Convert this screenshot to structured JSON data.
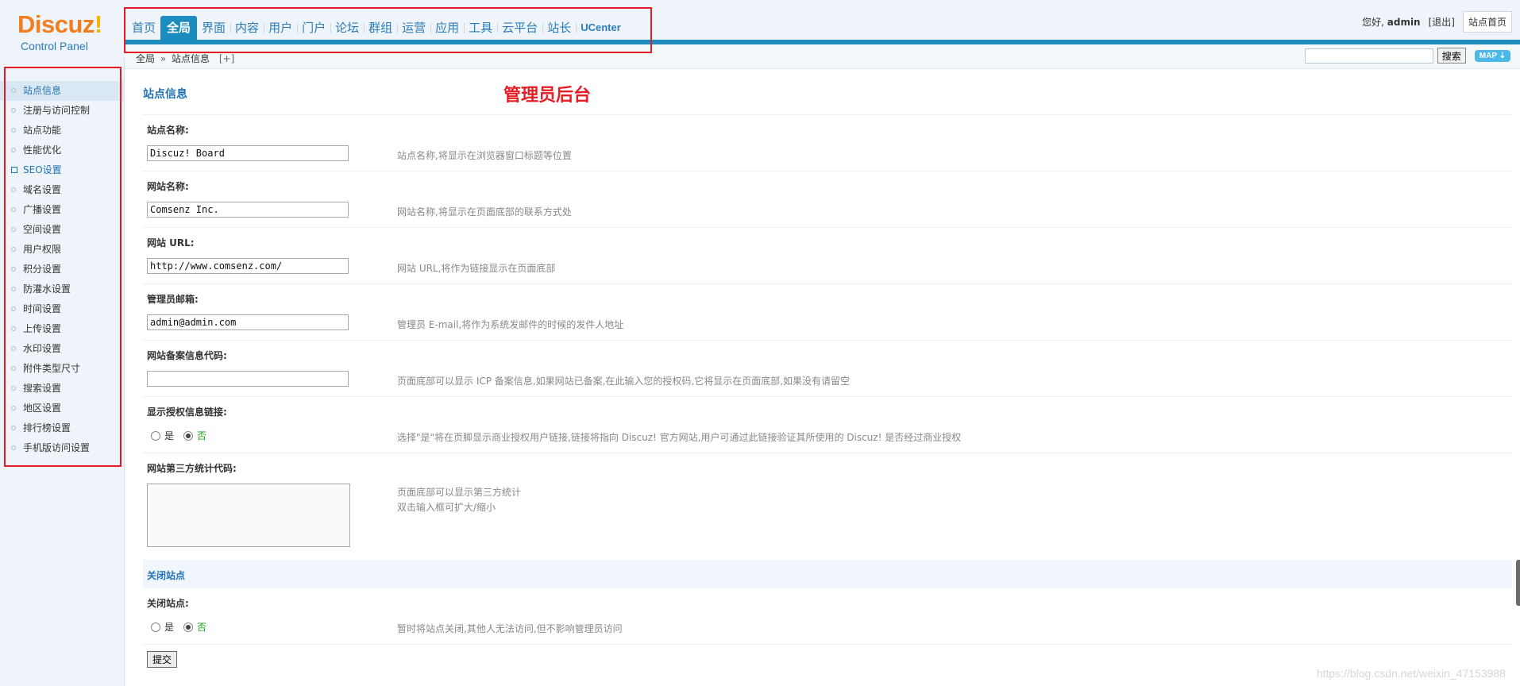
{
  "logo": {
    "name": "Discuz",
    "bang": "!",
    "subtitle": "Control Panel"
  },
  "topnav": [
    {
      "label": "首页",
      "active": false
    },
    {
      "label": "全局",
      "active": true
    },
    {
      "label": "界面",
      "active": false
    },
    {
      "label": "内容",
      "active": false
    },
    {
      "label": "用户",
      "active": false
    },
    {
      "label": "门户",
      "active": false
    },
    {
      "label": "论坛",
      "active": false
    },
    {
      "label": "群组",
      "active": false
    },
    {
      "label": "运营",
      "active": false
    },
    {
      "label": "应用",
      "active": false
    },
    {
      "label": "工具",
      "active": false
    },
    {
      "label": "云平台",
      "active": false
    },
    {
      "label": "站长",
      "active": false
    },
    {
      "label": "UCenter",
      "active": false
    }
  ],
  "user": {
    "greeting": "您好,",
    "name": "admin",
    "logout": "[退出]",
    "home_button": "站点首页"
  },
  "breadcrumb": {
    "root": "全局",
    "sep": "»",
    "current": "站点信息",
    "add": "[+]"
  },
  "search": {
    "value": "",
    "button": "搜索",
    "map": "MAP ⇣"
  },
  "sidebar": {
    "items": [
      {
        "label": "站点信息",
        "state": "active"
      },
      {
        "label": "注册与访问控制",
        "state": ""
      },
      {
        "label": "站点功能",
        "state": ""
      },
      {
        "label": "性能优化",
        "state": ""
      },
      {
        "label": "SEO设置",
        "state": "link"
      },
      {
        "label": "域名设置",
        "state": ""
      },
      {
        "label": "广播设置",
        "state": ""
      },
      {
        "label": "空间设置",
        "state": ""
      },
      {
        "label": "用户权限",
        "state": ""
      },
      {
        "label": "积分设置",
        "state": ""
      },
      {
        "label": "防灌水设置",
        "state": ""
      },
      {
        "label": "时间设置",
        "state": ""
      },
      {
        "label": "上传设置",
        "state": ""
      },
      {
        "label": "水印设置",
        "state": ""
      },
      {
        "label": "附件类型尺寸",
        "state": ""
      },
      {
        "label": "搜索设置",
        "state": ""
      },
      {
        "label": "地区设置",
        "state": ""
      },
      {
        "label": "排行榜设置",
        "state": ""
      },
      {
        "label": "手机版访问设置",
        "state": ""
      }
    ]
  },
  "main": {
    "title": "站点信息",
    "annotation": "管理员后台",
    "fields": [
      {
        "label": "站点名称:",
        "value": "Discuz! Board",
        "tip": "站点名称,将显示在浏览器窗口标题等位置"
      },
      {
        "label": "网站名称:",
        "value": "Comsenz Inc.",
        "tip": "网站名称,将显示在页面底部的联系方式处"
      },
      {
        "label": "网站 URL:",
        "value": "http://www.comsenz.com/",
        "tip": "网站 URL,将作为链接显示在页面底部"
      },
      {
        "label": "管理员邮箱:",
        "value": "admin@admin.com",
        "tip": "管理员 E-mail,将作为系统发邮件的时候的发件人地址"
      },
      {
        "label": "网站备案信息代码:",
        "value": "",
        "tip": "页面底部可以显示 ICP 备案信息,如果网站已备案,在此输入您的授权码,它将显示在页面底部,如果没有请留空"
      }
    ],
    "license_link": {
      "label": "显示授权信息链接:",
      "yes": "是",
      "no": "否",
      "tip": "选择\"是\"将在页脚显示商业授权用户链接,链接将指向 Discuz! 官方网站,用户可通过此链接验证其所使用的 Discuz! 是否经过商业授权"
    },
    "stats": {
      "label": "网站第三方统计代码:",
      "tip1": "页面底部可以显示第三方统计",
      "tip2": "双击输入框可扩大/缩小"
    },
    "close_section": {
      "title": "关闭站点",
      "label": "关闭站点:",
      "yes": "是",
      "no": "否",
      "tip": "暂时将站点关闭,其他人无法访问,但不影响管理员访问"
    },
    "submit": "提交"
  },
  "watermark": "https://blog.csdn.net/weixin_47153988"
}
